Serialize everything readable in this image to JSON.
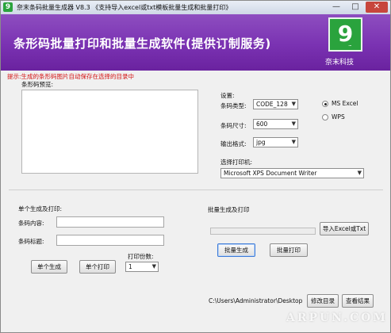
{
  "titlebar": {
    "app_icon_glyph": "9",
    "title": "奈末条码批量生成器 V8.3 《支持导入excel或txt模板批量生成和批量打印》",
    "minimize_glyph": "—",
    "maximize_glyph": "□",
    "close_glyph": "✕"
  },
  "banner": {
    "title": "条形码批量打印和批量生成软件(提供订制服务)",
    "logo_glyph": "9",
    "logo_dots": "...",
    "brand_name": "奈末科技"
  },
  "notice": "提示:生成的条形码图片自动保存在选择的目录中",
  "preview": {
    "label": "条形码预览:"
  },
  "settings": {
    "heading": "设置:",
    "barcode_type": {
      "label": "条码类型:",
      "value": "CODE_128"
    },
    "barcode_size": {
      "label": "条码尺寸:",
      "value": "600"
    },
    "output_format": {
      "label": "输出格式:",
      "value": "jpg"
    },
    "ms_excel": {
      "label": "MS  Excel",
      "selected": true
    },
    "wps": {
      "label": "WPS",
      "selected": false
    },
    "printer": {
      "label": "选择打印机:",
      "value": "Microsoft XPS Document Writer"
    },
    "dropdown_arrow": "▼"
  },
  "single": {
    "heading": "单个生成及打印:",
    "content_label": "条码内容:",
    "content_value": "",
    "title_label": "条码标题:",
    "title_value": "",
    "copies_label": "打印份数:",
    "copies_value": "1",
    "generate_button": "单个生成",
    "print_button": "单个打印"
  },
  "batch": {
    "heading": "批量生成及打印",
    "progress": 0,
    "import_button": "导入Excel或Txt",
    "generate_button": "批量生成",
    "print_button": "批量打印"
  },
  "output": {
    "path": "C:\\Users\\Administrator\\Desktop",
    "change_dir_button": "修改目录",
    "view_result_button": "查看结果"
  },
  "watermark": "ARPUN.COM",
  "colors": {
    "banner": "#7a32b2",
    "logo": "#2aa33d",
    "notice": "#d41313",
    "close": "#c7463c"
  }
}
